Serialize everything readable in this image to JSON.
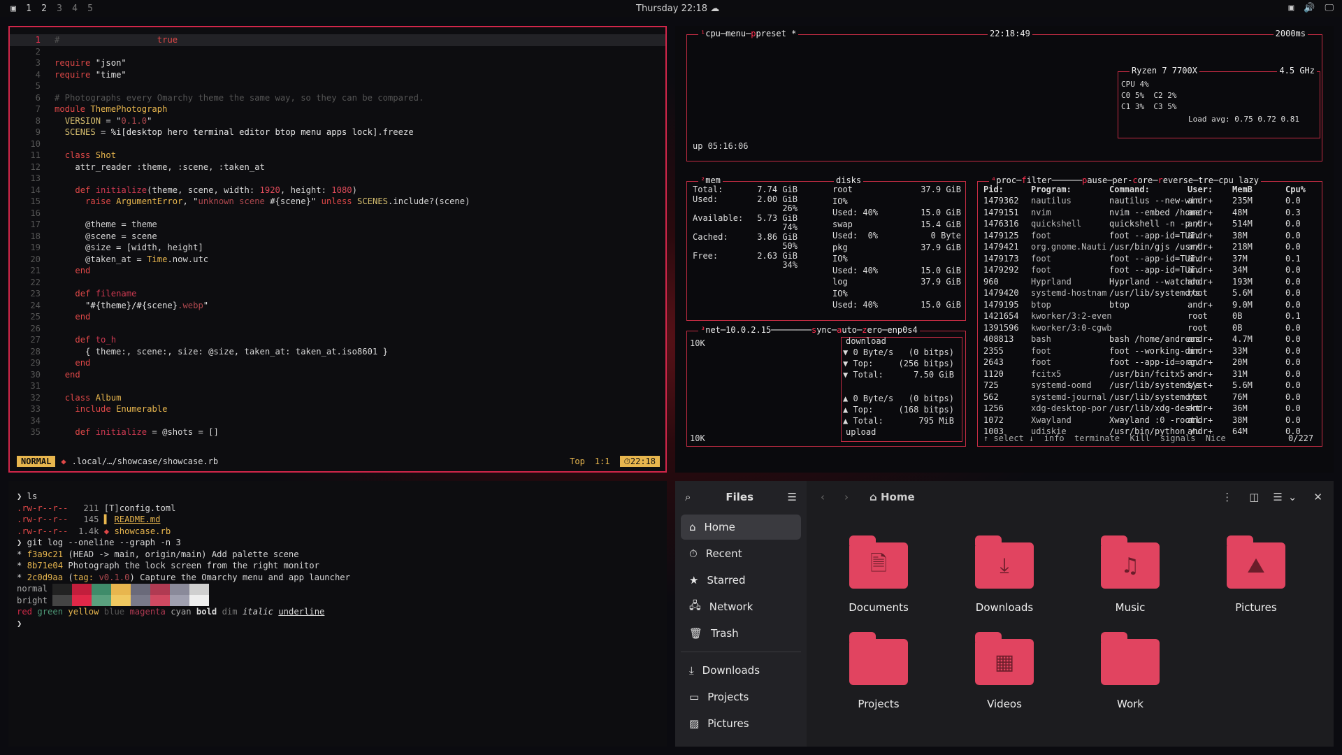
{
  "topbar": {
    "workspaces": [
      "1",
      "2",
      "3",
      "4",
      "5"
    ],
    "clock": "Thursday 22:18"
  },
  "editor": {
    "lines": [
      {
        "n": "1",
        "html": "<span class=\"c-cm\">#</span>                   <span class=\"c-kw\">true</span>"
      },
      {
        "n": "2",
        "html": ""
      },
      {
        "n": "3",
        "html": "<span class=\"c-kw\">require</span> <span class=\"c-str\">\"json\"</span>"
      },
      {
        "n": "4",
        "html": "<span class=\"c-kw\">require</span> <span class=\"c-str\">\"time\"</span>"
      },
      {
        "n": "5",
        "html": ""
      },
      {
        "n": "6",
        "html": "<span class=\"c-cm\"># Photographs every Omarchy theme the same way, so they can be compared.</span>"
      },
      {
        "n": "7",
        "html": "<span class=\"c-kw\">module</span> <span class=\"c-cls\">ThemePhotograph</span>"
      },
      {
        "n": "8",
        "html": "  <span class=\"c-const\">VERSION</span> = <span class=\"c-str\">\"</span><span class=\"c-strd\">0.1.0</span><span class=\"c-str\">\"</span>"
      },
      {
        "n": "9",
        "html": "  <span class=\"c-const\">SCENES</span> = <span class=\"c-str\">%i[desktop hero terminal editor btop menu apps lock]</span>.freeze"
      },
      {
        "n": "10",
        "html": ""
      },
      {
        "n": "11",
        "html": "  <span class=\"c-kw\">class</span> <span class=\"c-cls\">Shot</span>"
      },
      {
        "n": "12",
        "html": "    attr_reader :theme, :scene, :taken_at"
      },
      {
        "n": "13",
        "html": ""
      },
      {
        "n": "14",
        "html": "    <span class=\"c-kw\">def</span> <span class=\"c-def\">initialize</span>(theme, scene, width: <span class=\"c-num\">1920</span>, height: <span class=\"c-num\">1080</span>)"
      },
      {
        "n": "15",
        "html": "      <span class=\"c-kw\">raise</span> <span class=\"c-cls\">ArgumentError</span>, <span class=\"c-str\">\"</span><span class=\"c-strd\">unknown scene</span> #{scene}<span class=\"c-str\">\"</span> <span class=\"c-kw\">unless</span> <span class=\"c-const\">SCENES</span>.include?(scene)"
      },
      {
        "n": "16",
        "html": ""
      },
      {
        "n": "17",
        "html": "      @theme = theme"
      },
      {
        "n": "18",
        "html": "      @scene = scene"
      },
      {
        "n": "19",
        "html": "      @size = [width, height]"
      },
      {
        "n": "20",
        "html": "      @taken_at = <span class=\"c-cls\">Time</span>.now.utc"
      },
      {
        "n": "21",
        "html": "    <span class=\"c-kw\">end</span>"
      },
      {
        "n": "22",
        "html": ""
      },
      {
        "n": "23",
        "html": "    <span class=\"c-kw\">def</span> <span class=\"c-def\">filename</span>"
      },
      {
        "n": "24",
        "html": "      <span class=\"c-str\">\"#{theme}/#{scene}</span><span class=\"c-strd\">.webp</span><span class=\"c-str\">\"</span>"
      },
      {
        "n": "25",
        "html": "    <span class=\"c-kw\">end</span>"
      },
      {
        "n": "26",
        "html": ""
      },
      {
        "n": "27",
        "html": "    <span class=\"c-kw\">def</span> <span class=\"c-def\">to_h</span>"
      },
      {
        "n": "28",
        "html": "      { theme:, scene:, size: @size, taken_at: taken_at.iso8601 }"
      },
      {
        "n": "29",
        "html": "    <span class=\"c-kw\">end</span>"
      },
      {
        "n": "30",
        "html": "  <span class=\"c-kw\">end</span>"
      },
      {
        "n": "31",
        "html": ""
      },
      {
        "n": "32",
        "html": "  <span class=\"c-kw\">class</span> <span class=\"c-cls\">Album</span>"
      },
      {
        "n": "33",
        "html": "    <span class=\"c-kw\">include</span> <span class=\"c-cls\">Enumerable</span>"
      },
      {
        "n": "34",
        "html": ""
      },
      {
        "n": "35",
        "html": "    <span class=\"c-kw\">def</span> <span class=\"c-def\">initialize</span> = @shots = []"
      }
    ],
    "status": {
      "mode": "NORMAL",
      "path": ".local/…/showcase/showcase.rb",
      "scroll": "Top",
      "pos": "1:1",
      "clock": "22:18"
    }
  },
  "btop": {
    "cpu_title": "cpu",
    "menu": "menu",
    "preset": "preset *",
    "time": "22:18:49",
    "interval": "2000ms",
    "uptime": "up 05:16:06",
    "cpu_name": "Ryzen 7 7700X",
    "freq": "4.5 GHz",
    "cpu_rows": [
      "CPU 4%",
      "C0 5%  C2 2%",
      "C1 3%  C3 5%",
      "Load avg: 0.75 0.72 0.81"
    ],
    "mem": [
      [
        "Total:",
        "7.74 GiB"
      ],
      [
        "Used:",
        "2.00 GiB"
      ],
      [
        "",
        "26%"
      ],
      [
        "Available:",
        "5.73 GiB"
      ],
      [
        "",
        "74%"
      ],
      [
        "Cached:",
        "3.86 GiB"
      ],
      [
        "",
        "50%"
      ],
      [
        "Free:",
        "2.63 GiB"
      ],
      [
        "",
        "34%"
      ]
    ],
    "disks": [
      [
        "root",
        "37.9 GiB"
      ],
      [
        "IO%",
        ""
      ],
      [
        "Used: 40%",
        "15.0 GiB"
      ],
      [
        "swap",
        "15.4 GiB"
      ],
      [
        "Used:  0%",
        "0 Byte"
      ],
      [
        "pkg",
        "37.9 GiB"
      ],
      [
        "IO%",
        ""
      ],
      [
        "Used: 40%",
        "15.0 GiB"
      ],
      [
        "log",
        "37.9 GiB"
      ],
      [
        "IO%",
        ""
      ],
      [
        "Used: 40%",
        "15.0 GiB"
      ]
    ],
    "proc_header": [
      "Pid:",
      "Program:",
      "Command:",
      "User:",
      "MemB",
      "Cpu%"
    ],
    "procs": [
      [
        "1479362",
        "nautilus",
        "nautilus --new-win",
        "andr+",
        "235M",
        "0.0"
      ],
      [
        "1479151",
        "nvim",
        "nvim --embed /home",
        "andr+",
        "48M",
        "0.3"
      ],
      [
        "1476316",
        "quickshell",
        "quickshell -n -p /",
        "andr+",
        "514M",
        "0.0"
      ],
      [
        "1479125",
        "foot",
        "foot --app-id=TUI.",
        "andr+",
        "38M",
        "0.0"
      ],
      [
        "1479421",
        "org.gnome.Nauti",
        "/usr/bin/gjs /usr/",
        "andr+",
        "218M",
        "0.0"
      ],
      [
        "1479173",
        "foot",
        "foot --app-id=TUI.",
        "andr+",
        "37M",
        "0.1"
      ],
      [
        "1479292",
        "foot",
        "foot --app-id=TUI.",
        "andr+",
        "34M",
        "0.0"
      ],
      [
        "960",
        "Hyprland",
        "Hyprland --watchdo",
        "andr+",
        "193M",
        "0.0"
      ],
      [
        "1479420",
        "systemd-hostnam",
        "/usr/lib/systemd/s",
        "root",
        "5.6M",
        "0.0"
      ],
      [
        "1479195",
        "btop",
        "btop",
        "andr+",
        "9.0M",
        "0.0"
      ],
      [
        "1421654",
        "kworker/3:2-even",
        "",
        "root",
        "0B",
        "0.1"
      ],
      [
        "1391596",
        "kworker/3:0-cgwb",
        "",
        "root",
        "0B",
        "0.0"
      ],
      [
        "408813",
        "bash",
        "bash /home/andreas",
        "andr+",
        "4.7M",
        "0.0"
      ],
      [
        "2355",
        "foot",
        "foot --working-dir",
        "andr+",
        "33M",
        "0.0"
      ],
      [
        "2643",
        "foot",
        "foot --app-id=org.",
        "andr+",
        "20M",
        "0.0"
      ],
      [
        "1120",
        "fcitx5",
        "/usr/bin/fcitx5 --",
        "andr+",
        "31M",
        "0.0"
      ],
      [
        "725",
        "systemd-oomd",
        "/usr/lib/systemd/s",
        "syst+",
        "5.6M",
        "0.0"
      ],
      [
        "562",
        "systemd-journal",
        "/usr/lib/systemd/s",
        "root",
        "76M",
        "0.0"
      ],
      [
        "1256",
        "xdg-desktop-por",
        "/usr/lib/xdg-deskt",
        "andr+",
        "36M",
        "0.0"
      ],
      [
        "1072",
        "Xwayland",
        "Xwayland :0 -rootl",
        "andr+",
        "38M",
        "0.0"
      ],
      [
        "1003",
        "udiskie",
        "/usr/bin/python /u",
        "andr+",
        "64M",
        "0.0"
      ]
    ],
    "proc_footer": "0/227",
    "net_ip": "10.0.2.15",
    "net_iface": "enp0s4",
    "net_scale": "10K",
    "download": [
      "download",
      "▼ 0 Byte/s   (0 bitps)",
      "▼ Top:     (256 bitps)",
      "▼ Total:      7.50 GiB"
    ],
    "upload": [
      "▲ 0 Byte/s   (0 bitps)",
      "▲ Top:     (168 bitps)",
      "▲ Total:       795 MiB",
      "upload"
    ]
  },
  "terminal": {
    "lines": [
      "<span style=\"color:#ddd\">❯</span> ls",
      "<span class=\"c-kw\">.rw-r--r--</span>   <span style=\"color:#999\">211</span> <span style=\"color:#ccc\">[T]</span>config.toml",
      "<span class=\"c-kw\">.rw-r--r--</span>   <span style=\"color:#999\">145</span> <span style=\"color:#e8b64e\">▌</span> <span style=\"color:#e8b64e;text-decoration:underline\">README.md</span>",
      "<span class=\"c-kw\">.rw-r--r--</span>  <span style=\"color:#999\">1.4k</span> <span style=\"color:#e04848\">◆</span> <span style=\"color:#e8b64e\">showcase.rb</span>",
      "<span style=\"color:#ddd\">❯</span> git log --oneline --graph -n 3",
      "* <span style=\"color:#e8b64e\">f3a9c21</span> (HEAD -&gt; main, origin/main) Add palette scene",
      "* <span style=\"color:#e8b64e\">8b71e04</span> Photograph the lock screen from the right monitor",
      "* <span style=\"color:#e8b64e\">2c0d9aa</span> (<span style=\"color:#e8b64e\">tag: </span><span class=\"c-strd\">v0.1.0</span>) Capture the Omarchy menu and app launcher",
      "<span style=\"color:#aaa\">normal </span><span class=\"swatch\" style=\"background:#222\"></span><span class=\"swatch\" style=\"background:#c21e3c\"></span><span class=\"swatch\" style=\"background:#3f8c6a\"></span><span class=\"swatch\" style=\"background:#e8b64e\"></span><span class=\"swatch\" style=\"background:#6a6a7a\"></span><span class=\"swatch\" style=\"background:#b03a52\"></span><span class=\"swatch\" style=\"background:#8a8a9a\"></span><span class=\"swatch\" style=\"background:#cfcfcf\"></span>",
      "<span style=\"color:#aaa\">bright </span><span class=\"swatch\" style=\"background:#444\"></span><span class=\"swatch\" style=\"background:#e02848\"></span><span class=\"swatch\" style=\"background:#5aa07e\"></span><span class=\"swatch\" style=\"background:#f0c860\"></span><span class=\"swatch\" style=\"background:#7a7a8a\"></span><span class=\"swatch\" style=\"background:#d04a62\"></span><span class=\"swatch\" style=\"background:#a0a0b0\"></span><span class=\"swatch\" style=\"background:#eeeeee\"></span>",
      "<span style=\"color:#d02a48\">red</span> <span style=\"color:#4e9a78\">green</span> <span style=\"color:#e8b64e\">yellow</span> <span style=\"color:#555\">blue</span> <span style=\"color:#b03a52\">magenta</span> <span style=\"color:#aaa\">cyan</span> <b>bold</b> <span style=\"color:#777\">dim</span> <i>italic</i> <u>underline</u>",
      "<span style=\"color:#ddd\">❯</span>"
    ]
  },
  "files": {
    "app_title": "Files",
    "location": "Home",
    "sidebar": [
      "Home",
      "Recent",
      "Starred",
      "Network",
      "Trash",
      "Downloads",
      "Projects",
      "Pictures"
    ],
    "folders": [
      {
        "label": "Documents",
        "glyph": "🗎"
      },
      {
        "label": "Downloads",
        "glyph": "⤓"
      },
      {
        "label": "Music",
        "glyph": "♫"
      },
      {
        "label": "Pictures",
        "glyph": "⛰"
      },
      {
        "label": "Projects",
        "glyph": ""
      },
      {
        "label": "Videos",
        "glyph": "▦"
      },
      {
        "label": "Work",
        "glyph": ""
      }
    ]
  }
}
